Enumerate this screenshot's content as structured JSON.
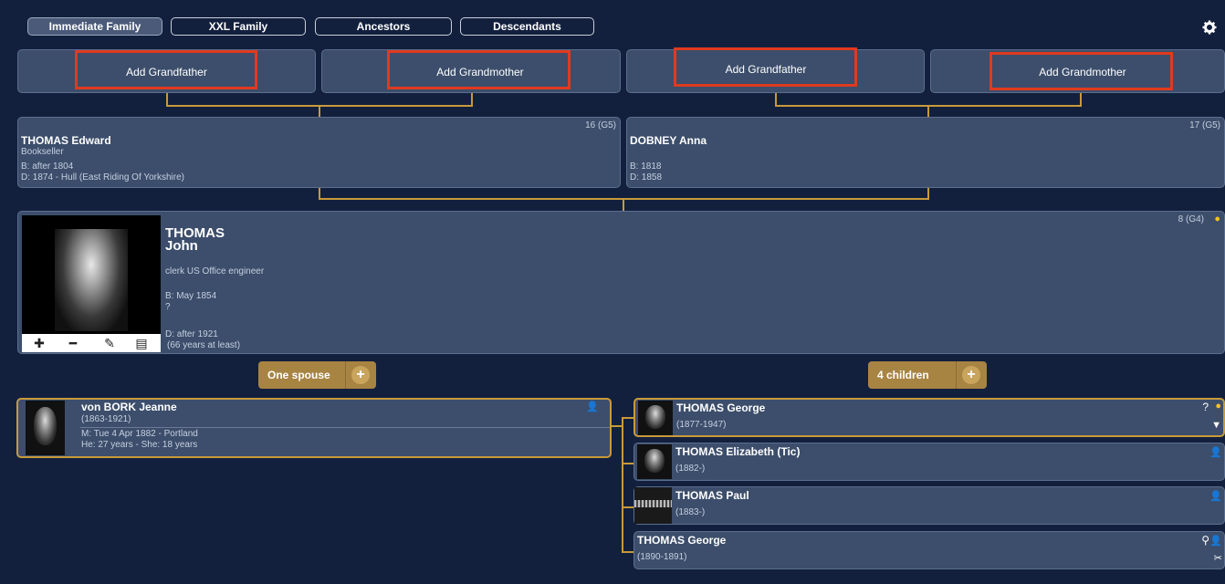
{
  "tabs": [
    {
      "label": "Immediate Family",
      "active": true
    },
    {
      "label": "XXL Family",
      "active": false
    },
    {
      "label": "Ancestors",
      "active": false
    },
    {
      "label": "Descendants",
      "active": false
    }
  ],
  "grandparents": {
    "add_grandfather_1": "Add Grandfather",
    "add_grandmother_1": "Add Grandmother",
    "add_grandfather_2": "Add Grandfather",
    "add_grandmother_2": "Add Grandmother"
  },
  "father": {
    "name": "THOMAS Edward",
    "occupation": "Bookseller",
    "birth": "B: after 1804",
    "death": "D: 1874 - Hull (East Riding Of Yorkshire)",
    "gen": "16 (G5)"
  },
  "mother": {
    "name": "DOBNEY Anna",
    "birth": "B: 1818",
    "death": "D: 1858",
    "gen": "17 (G5)"
  },
  "main": {
    "surname": "THOMAS",
    "given": "John",
    "occupation": "clerk US Office engineer",
    "birth": "B: May 1854",
    "birth_place": "?",
    "death": "D: after 1921",
    "age": "(66 years at least)",
    "gen": "8 (G4)"
  },
  "spouse_pill": {
    "label": "One spouse"
  },
  "children_pill": {
    "label": "4 children"
  },
  "spouse": {
    "name": "von BORK Jeanne",
    "dates": "(1863-1921)",
    "marriage": "M: Tue 4 Apr 1882 - Portland",
    "ages": "He: 27 years - She: 18 years"
  },
  "children": [
    {
      "name": "THOMAS George",
      "dates": "(1877-1947)"
    },
    {
      "name": "THOMAS Elizabeth (Tic)",
      "dates": "(1882-)"
    },
    {
      "name": "THOMAS Paul",
      "dates": "(1883-)"
    },
    {
      "name": "THOMAS George",
      "dates": "(1890-1891)"
    }
  ],
  "colors": {
    "background": "#13203d",
    "panel": "#3c4e6b",
    "accent_gold": "#c79a3a",
    "highlight_red": "#e03a1e"
  },
  "icons": {
    "settings": "gear-icon",
    "female": "female-person-icon",
    "male": "male-person-icon",
    "bulb": "lightbulb-icon"
  }
}
